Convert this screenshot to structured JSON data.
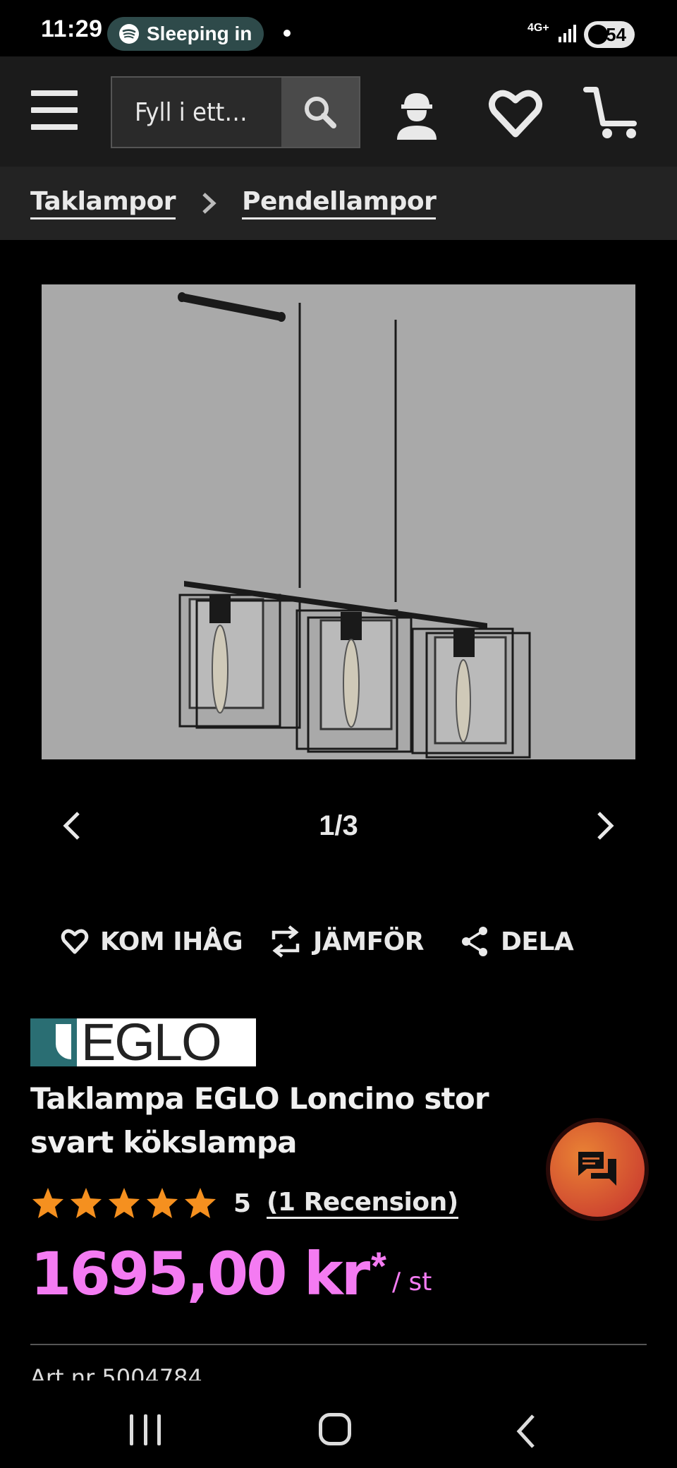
{
  "status_bar": {
    "time": "11:29",
    "now_playing": "Sleeping in",
    "network": "4G+",
    "battery": "54"
  },
  "header": {
    "search_placeholder": "Fyll i ett…",
    "icons": [
      "menu-icon",
      "search-icon",
      "account-icon",
      "heart-icon",
      "cart-icon"
    ]
  },
  "breadcrumb": {
    "items": [
      {
        "label": "Taklampor"
      },
      {
        "label": "Pendellampor"
      }
    ]
  },
  "carousel": {
    "counter": "1/3",
    "current": 1,
    "total": 3
  },
  "actions": {
    "remember": "KOM IHÅG",
    "compare": "JÄMFÖR",
    "share": "DELA"
  },
  "product": {
    "brand": "EGLO",
    "title": "Taklampa EGLO Loncino stor svart kökslampa",
    "rating_value": "5",
    "rating_stars": 5,
    "reviews_link": "(1 Recension)",
    "price": "1695,00 kr",
    "price_asterisk": "*",
    "price_unit": "/ st",
    "art_nr": "Art.nr 5004784"
  },
  "colors": {
    "background": "#000000",
    "header": "#1b1b1b",
    "breadcrumb_bg": "#232323",
    "price": "#f47bf2",
    "stars": "#f5901f",
    "chat_gradient_start": "#e98234",
    "chat_gradient_end": "#c5302f",
    "image_bg": "#a9a9a9"
  }
}
